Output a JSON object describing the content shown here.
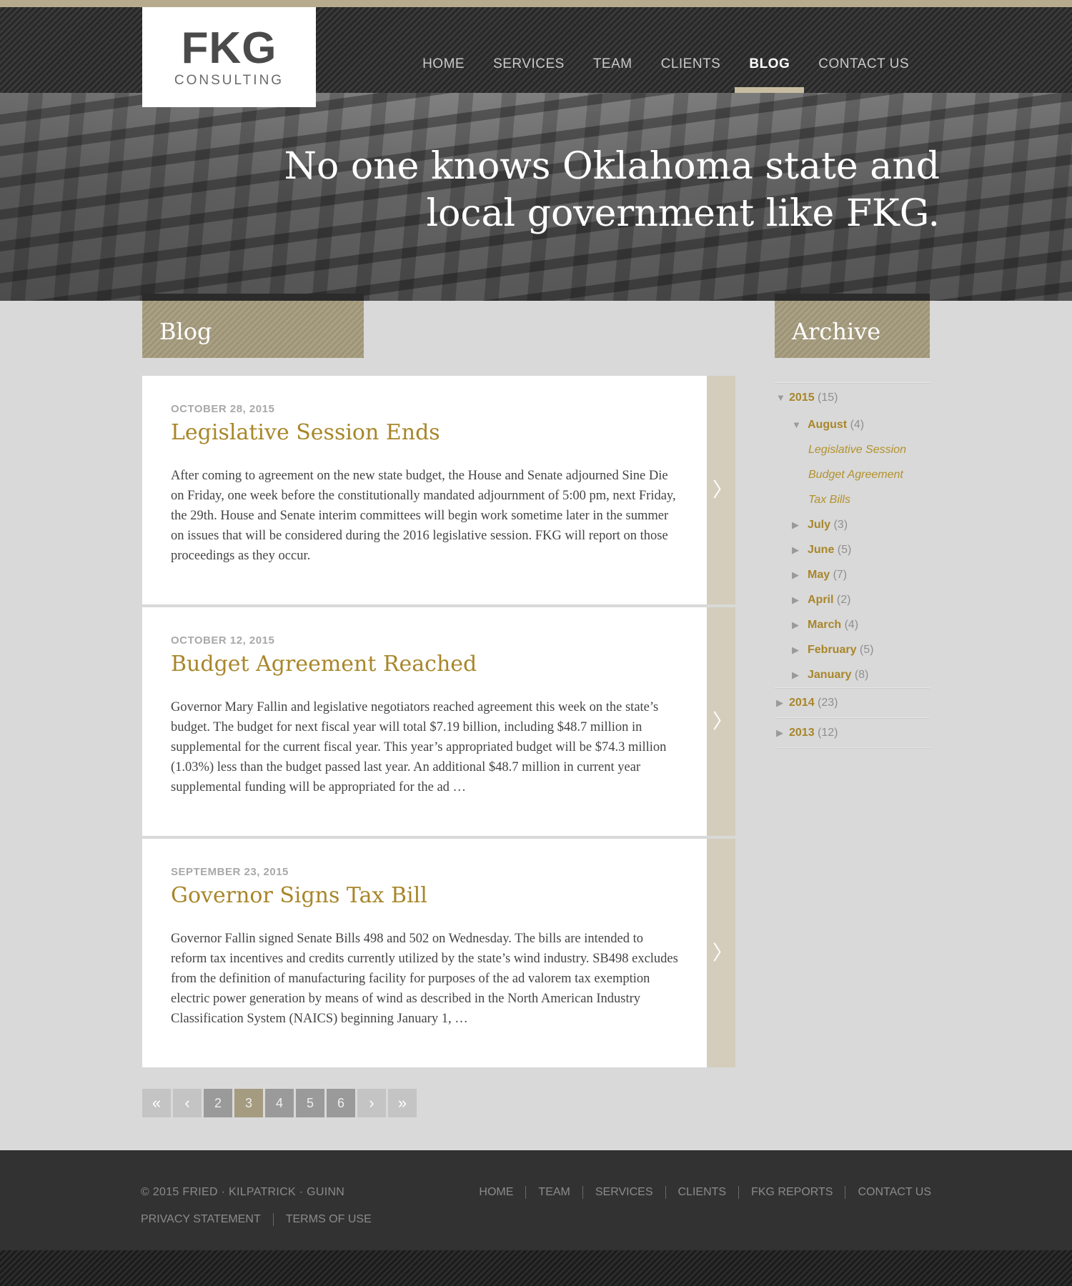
{
  "logo": {
    "mark": "FKG",
    "sub": "CONSULTING"
  },
  "nav": [
    {
      "label": "HOME"
    },
    {
      "label": "SERVICES"
    },
    {
      "label": "TEAM"
    },
    {
      "label": "CLIENTS"
    },
    {
      "label": "BLOG",
      "active": true
    },
    {
      "label": "CONTACT US"
    }
  ],
  "hero": {
    "line1": "No one knows Oklahoma state and",
    "line2": "local government like FKG."
  },
  "blog": {
    "heading": "Blog"
  },
  "archive_heading": "Archive",
  "posts": [
    {
      "date": "OCTOBER 28, 2015",
      "title": "Legislative Session Ends",
      "body": "After coming to agreement on the new state budget, the House and Senate adjourned Sine Die on Friday, one week before the constitutionally mandated adjournment of 5:00 pm, next Friday, the 29th. House and Senate interim committees will begin work sometime later in the summer on issues that will be considered during the 2016 legislative session. FKG will report on those proceedings as they occur."
    },
    {
      "date": "OCTOBER 12, 2015",
      "title": "Budget Agreement Reached",
      "body": "Governor Mary Fallin and legislative negotiators reached agreement this week on the state’s budget. The budget for next fiscal year will total $7.19 billion, including $48.7 million in supplemental for the current fiscal year. This year’s appropriated budget will be $74.3 million (1.03%) less than the budget passed last year. An additional $48.7 million in current year supplemental funding will be appropriated for the ad …"
    },
    {
      "date": "SEPTEMBER 23, 2015",
      "title": "Governor Signs Tax Bill",
      "body": "Governor Fallin signed Senate Bills 498 and 502 on Wednesday. The bills are intended to reform tax incentives and credits currently utilized by the state’s wind industry. SB498 excludes from the definition of manufacturing facility for purposes of the ad valorem tax exemption electric power generation by means of wind as described in the North American Industry Classification System (NAICS) beginning January 1, …"
    }
  ],
  "pager": {
    "first": "«",
    "prev": "‹",
    "pages": [
      "2",
      "3",
      "4",
      "5",
      "6"
    ],
    "current": "3",
    "next": "›",
    "last": "»"
  },
  "archive": {
    "y2015": {
      "year": "2015",
      "count": "(15)"
    },
    "august": {
      "month": "August",
      "count": "(4)"
    },
    "august_posts": [
      "Legislative Session",
      "Budget Agreement",
      "Tax Bills"
    ],
    "months": [
      {
        "month": "July",
        "count": "(3)"
      },
      {
        "month": "June",
        "count": "(5)"
      },
      {
        "month": "May",
        "count": "(7)"
      },
      {
        "month": "April",
        "count": "(2)"
      },
      {
        "month": "March",
        "count": "(4)"
      },
      {
        "month": "February",
        "count": "(5)"
      },
      {
        "month": "January",
        "count": "(8)"
      }
    ],
    "y2014": {
      "year": "2014",
      "count": "(23)"
    },
    "y2013": {
      "year": "2013",
      "count": "(12)"
    }
  },
  "footer": {
    "copyright": "© 2015  FRIED · KILPATRICK · GUINN",
    "privacy": "PRIVACY STATEMENT",
    "terms": "TERMS OF USE",
    "nav": [
      "HOME",
      "TEAM",
      "SERVICES",
      "CLIENTS",
      "FKG REPORTS",
      "CONTACT US"
    ]
  },
  "colors": {
    "accent": "#a8862a",
    "tab": "#a59b80",
    "footer": "#323232"
  }
}
